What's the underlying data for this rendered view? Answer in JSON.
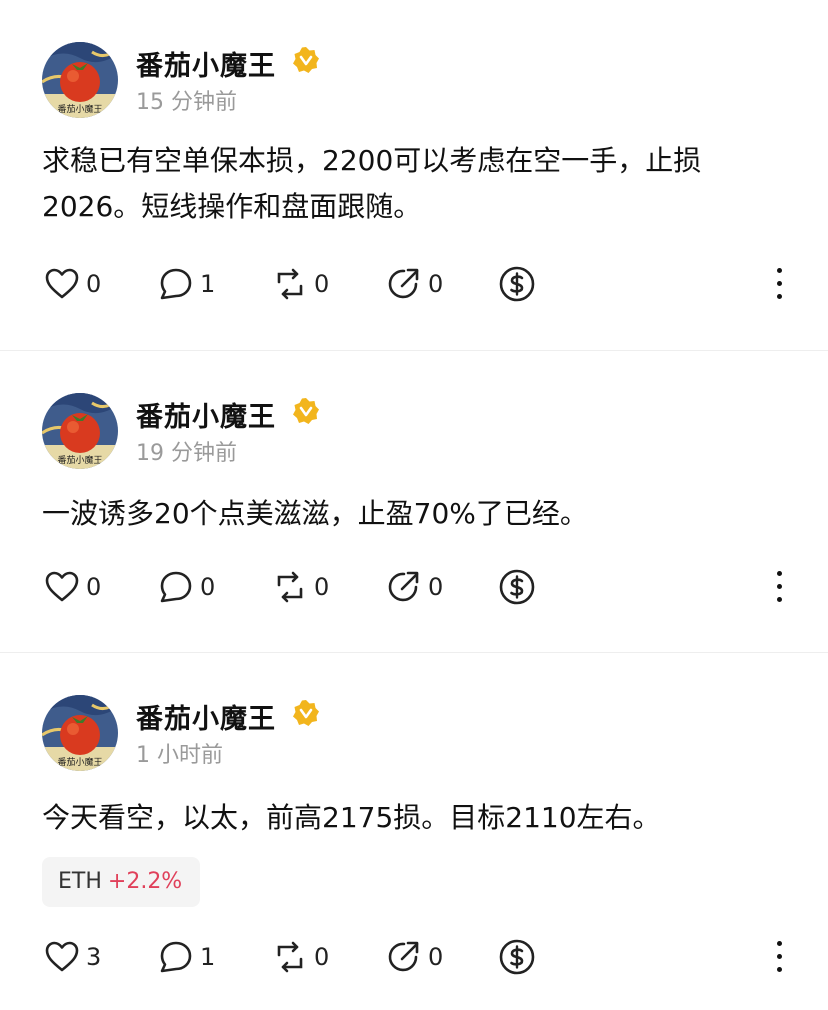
{
  "posts": [
    {
      "author": "番茄小魔王",
      "time": "15 分钟前",
      "content_lines": [
        "求稳已有空单保本损，2200可以考虑在空一手，止损",
        "2026。短线操作和盘面跟随。"
      ],
      "likes": "0",
      "comments": "1",
      "reposts": "0",
      "shares": "0"
    },
    {
      "author": "番茄小魔王",
      "time": "19 分钟前",
      "content_lines": [
        "一波诱多20个点美滋滋，止盈70%了已经。"
      ],
      "likes": "0",
      "comments": "0",
      "reposts": "0",
      "shares": "0"
    },
    {
      "author": "番茄小魔王",
      "time": "1 小时前",
      "content_lines": [
        "今天看空，以太，前高2175损。目标2110左右。"
      ],
      "tag": {
        "symbol": "ETH",
        "change": "+2.2%"
      },
      "likes": "3",
      "comments": "1",
      "reposts": "0",
      "shares": "0"
    }
  ],
  "avatar_text": "番茄小魔王",
  "icons": {
    "like": "heart-icon",
    "comment": "comment-bubble-icon",
    "repost": "repost-icon",
    "share": "share-arrow-icon",
    "tip": "dollar-coin-icon",
    "more": "more-vertical-icon",
    "verified": "verified-badge-icon"
  },
  "colors": {
    "verified_badge": "#f2b51d",
    "positive_change": "#e0405a",
    "time_text": "#9a9a9a",
    "divider": "#eeeeee"
  }
}
